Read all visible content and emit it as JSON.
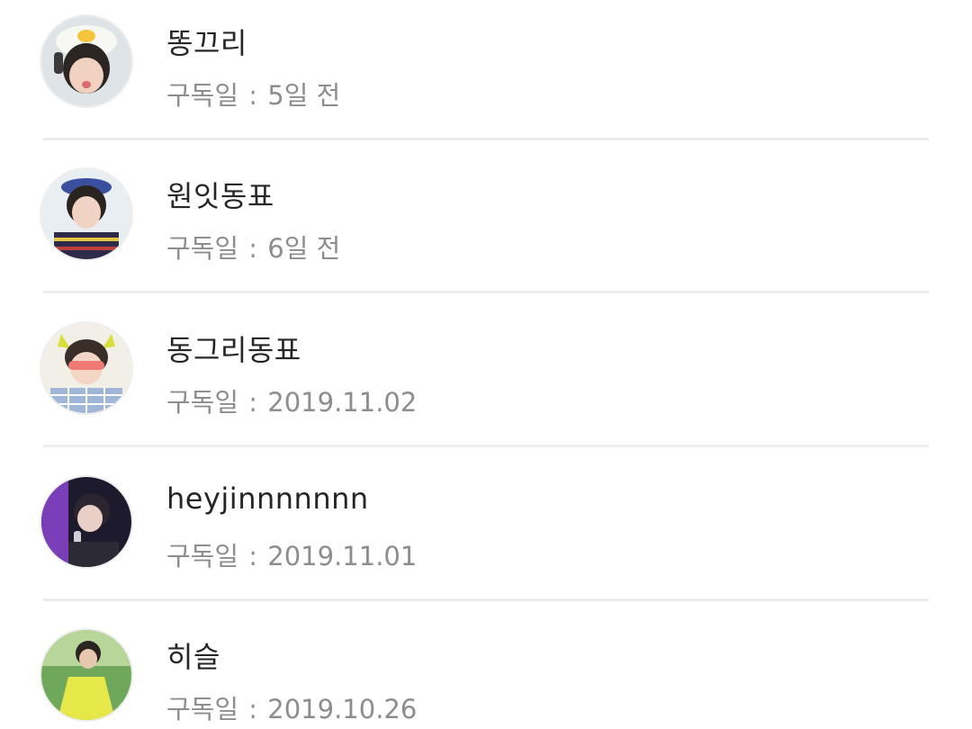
{
  "subscribers": [
    {
      "name": "똥끄리",
      "label": "구독일",
      "separator": " : ",
      "date": "5일 전",
      "avatar_icon": "avatar-photo"
    },
    {
      "name": "원잇동표",
      "label": "구독일",
      "separator": " : ",
      "date": "6일 전",
      "avatar_icon": "avatar-photo"
    },
    {
      "name": "동그리동표",
      "label": "구독일",
      "separator": " : ",
      "date": "2019.11.02",
      "avatar_icon": "avatar-photo"
    },
    {
      "name": "heyjinnnnnnn",
      "label": "구독일",
      "separator": " : ",
      "date": "2019.11.01",
      "avatar_icon": "avatar-photo"
    },
    {
      "name": "히슬",
      "label": "구독일",
      "separator": " : ",
      "date": "2019.10.26",
      "avatar_icon": "avatar-photo"
    }
  ],
  "colors": {
    "name_text": "#262626",
    "sub_text": "#8d8d8d",
    "divider": "#ececec",
    "background": "#ffffff"
  }
}
